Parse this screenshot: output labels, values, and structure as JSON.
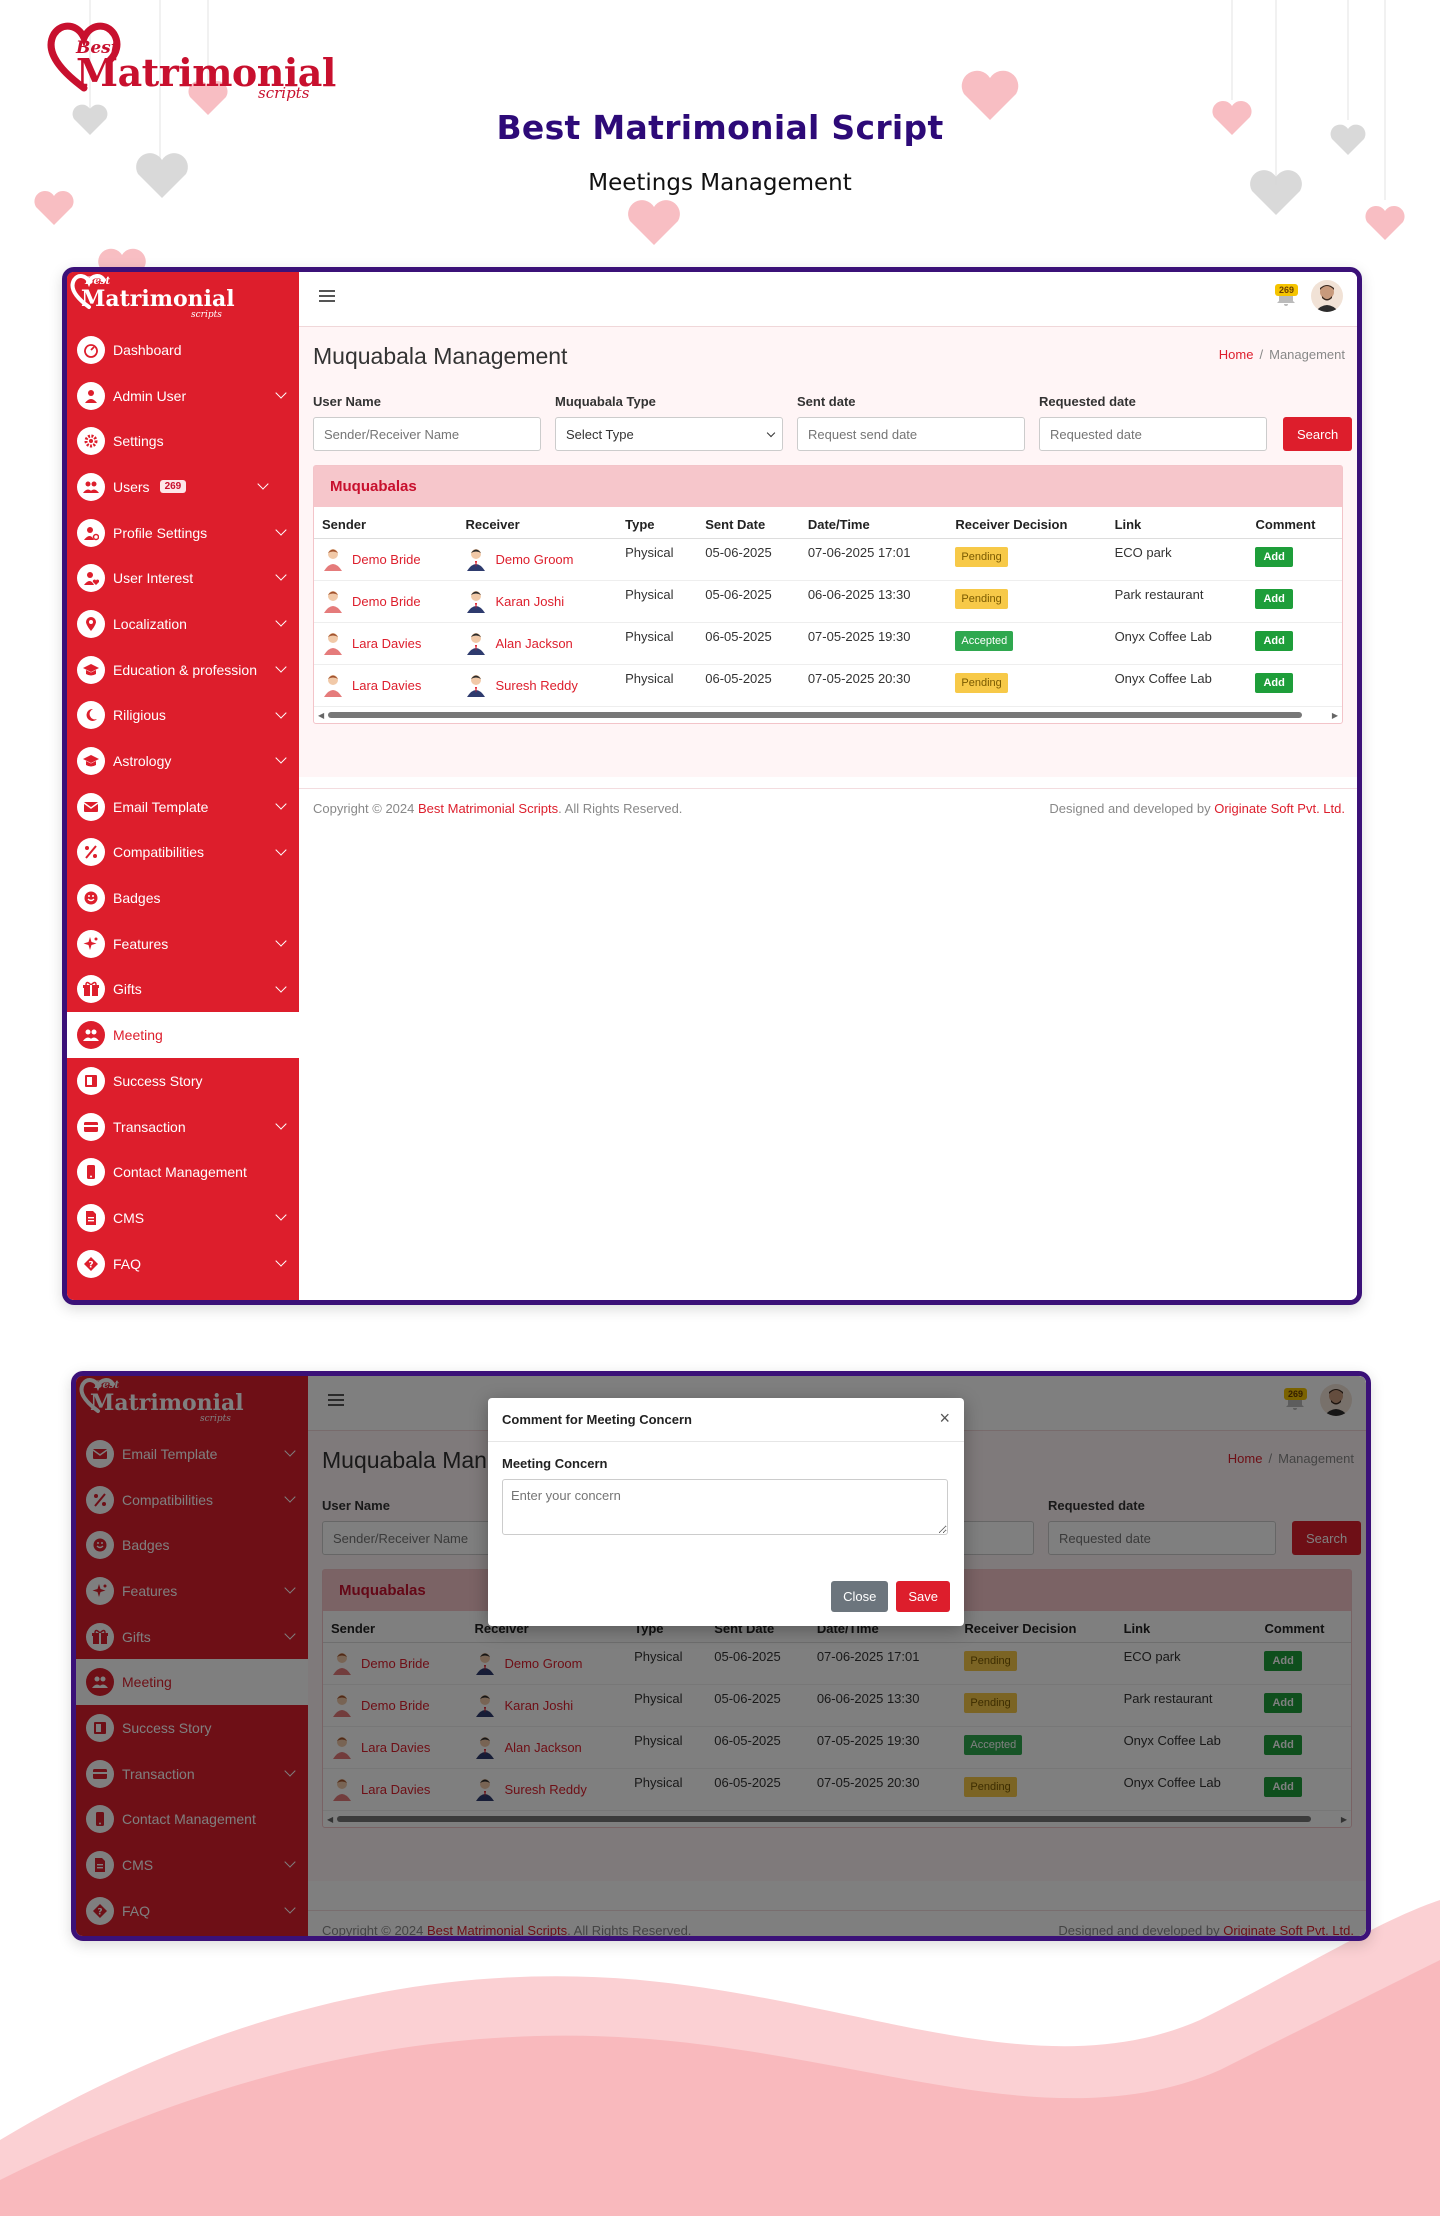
{
  "brand": {
    "best": "Best",
    "name": "Matrimonial",
    "scripts": "scripts"
  },
  "hero": {
    "title": "Best Matrimonial Script",
    "subtitle": "Meetings Management"
  },
  "sidebar": {
    "items": [
      {
        "label": "Dashboard",
        "icon": "dashboard-icon",
        "chevron": false
      },
      {
        "label": "Admin User",
        "icon": "user-icon",
        "chevron": true
      },
      {
        "label": "Settings",
        "icon": "gear-icon",
        "chevron": false
      },
      {
        "label": "Users",
        "icon": "users-icon",
        "chevron": true,
        "badge": "269"
      },
      {
        "label": "Profile Settings",
        "icon": "user-gear-icon",
        "chevron": true
      },
      {
        "label": "User Interest",
        "icon": "user-heart-icon",
        "chevron": true
      },
      {
        "label": "Localization",
        "icon": "map-pin-icon",
        "chevron": true
      },
      {
        "label": "Education & profession",
        "icon": "graduation-cap-icon",
        "chevron": true
      },
      {
        "label": "Riligious",
        "icon": "religion-icon",
        "chevron": true
      },
      {
        "label": "Astrology",
        "icon": "astrology-icon",
        "chevron": true
      },
      {
        "label": "Email Template",
        "icon": "envelope-icon",
        "chevron": true
      },
      {
        "label": "Compatibilities",
        "icon": "percent-icon",
        "chevron": true
      },
      {
        "label": "Badges",
        "icon": "badge-icon",
        "chevron": false
      },
      {
        "label": "Features",
        "icon": "sparkle-icon",
        "chevron": true
      },
      {
        "label": "Gifts",
        "icon": "gift-icon",
        "chevron": true
      },
      {
        "label": "Meeting",
        "icon": "meeting-icon",
        "chevron": false,
        "active": true
      },
      {
        "label": "Success Story",
        "icon": "book-icon",
        "chevron": false
      },
      {
        "label": "Transaction",
        "icon": "card-icon",
        "chevron": true
      },
      {
        "label": "Contact Management",
        "icon": "phone-icon",
        "chevron": false
      },
      {
        "label": "CMS",
        "icon": "document-icon",
        "chevron": true
      },
      {
        "label": "FAQ",
        "icon": "question-icon",
        "chevron": true
      }
    ],
    "items2": [
      {
        "label": "Email Template",
        "icon": "envelope-icon",
        "chevron": true
      },
      {
        "label": "Compatibilities",
        "icon": "percent-icon",
        "chevron": true
      },
      {
        "label": "Badges",
        "icon": "badge-icon",
        "chevron": false
      },
      {
        "label": "Features",
        "icon": "sparkle-icon",
        "chevron": true
      },
      {
        "label": "Gifts",
        "icon": "gift-icon",
        "chevron": true
      },
      {
        "label": "Meeting",
        "icon": "meeting-icon",
        "chevron": false,
        "active": true
      },
      {
        "label": "Success Story",
        "icon": "book-icon",
        "chevron": false
      },
      {
        "label": "Transaction",
        "icon": "card-icon",
        "chevron": true
      },
      {
        "label": "Contact Management",
        "icon": "phone-icon",
        "chevron": false
      },
      {
        "label": "CMS",
        "icon": "document-icon",
        "chevron": true
      },
      {
        "label": "FAQ",
        "icon": "question-icon",
        "chevron": true
      }
    ]
  },
  "topbar": {
    "notification_count": "269"
  },
  "page": {
    "title": "Muquabala Management",
    "breadcrumb_home": "Home",
    "breadcrumb_sep": "/",
    "breadcrumb_current": "Management"
  },
  "filters": {
    "user_name_label": "User Name",
    "user_name_placeholder": "Sender/Receiver Name",
    "type_label": "Muquabala Type",
    "type_value": "Select Type",
    "sent_label": "Sent date",
    "sent_placeholder": "Request send date",
    "requested_label": "Requested date",
    "requested_placeholder": "Requested date",
    "search_label": "Search"
  },
  "table": {
    "card_title": "Muquabalas",
    "headers": [
      "Sender",
      "Receiver",
      "Type",
      "Sent Date",
      "Date/Time",
      "Receiver Decision",
      "Link",
      "Comment"
    ],
    "add_label": "Add",
    "rows": [
      {
        "sender": "Demo Bride",
        "receiver": "Demo Groom",
        "type": "Physical",
        "sent": "05-06-2025",
        "datetime": "07-06-2025 17:01",
        "decision": "Pending",
        "link": "ECO park"
      },
      {
        "sender": "Demo Bride",
        "receiver": "Karan Joshi",
        "type": "Physical",
        "sent": "05-06-2025",
        "datetime": "06-06-2025 13:30",
        "decision": "Pending",
        "link": "Park restaurant"
      },
      {
        "sender": "Lara Davies",
        "receiver": "Alan Jackson",
        "type": "Physical",
        "sent": "06-05-2025",
        "datetime": "07-05-2025 19:30",
        "decision": "Accepted",
        "link": "Onyx Coffee Lab"
      },
      {
        "sender": "Lara Davies",
        "receiver": "Suresh Reddy",
        "type": "Physical",
        "sent": "06-05-2025",
        "datetime": "07-05-2025 20:30",
        "decision": "Pending",
        "link": "Onyx Coffee Lab"
      }
    ]
  },
  "footer": {
    "copyright_prefix": "Copyright © 2024 ",
    "brand": "Best Matrimonial Scripts",
    "copyright_suffix": ". All Rights Reserved.",
    "designed_prefix": "Designed and developed by ",
    "company": "Originate Soft Pvt. Ltd."
  },
  "modal": {
    "title": "Comment for Meeting Concern",
    "field_label": "Meeting Concern",
    "placeholder": "Enter your concern",
    "close_label": "Close",
    "save_label": "Save"
  },
  "colors": {
    "accent": "#dd1e2c",
    "frame": "#3b1178",
    "title": "#2d0a78"
  }
}
